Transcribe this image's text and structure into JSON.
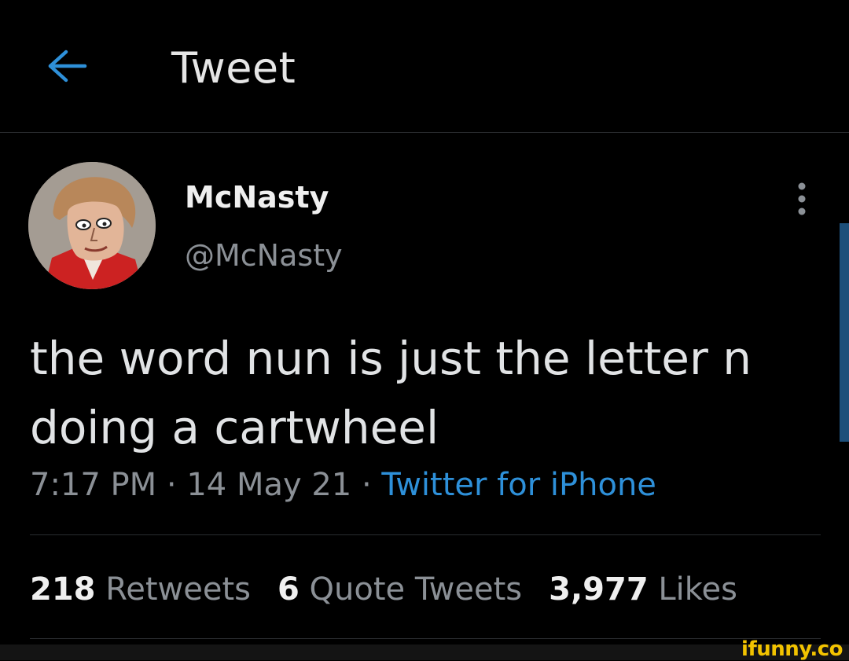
{
  "header": {
    "back_icon": "arrow-left-icon",
    "title": "Tweet"
  },
  "author": {
    "display_name": "McNasty",
    "handle": "@McNasty",
    "avatar_icon": "avatar-image",
    "more_icon": "vertical-ellipsis-icon"
  },
  "tweet": {
    "text": "the word nun is just the letter n doing a cartwheel",
    "time": "7:17 PM",
    "separator_1": " · ",
    "date": "14 May 21",
    "separator_2": " · ",
    "source": "Twitter for iPhone"
  },
  "stats": {
    "retweets_count": "218",
    "retweets_label": "Retweets",
    "quotes_count": "6",
    "quotes_label": "Quote Tweets",
    "likes_count": "3,977",
    "likes_label": "Likes"
  },
  "watermark": {
    "text": "ifunny.co"
  },
  "colors": {
    "background": "#000000",
    "accent": "#2e90d9",
    "primary_text": "#e1e3e5",
    "secondary_text": "#8b9096",
    "divider": "#2a2d30",
    "watermark": "#f2c300"
  }
}
